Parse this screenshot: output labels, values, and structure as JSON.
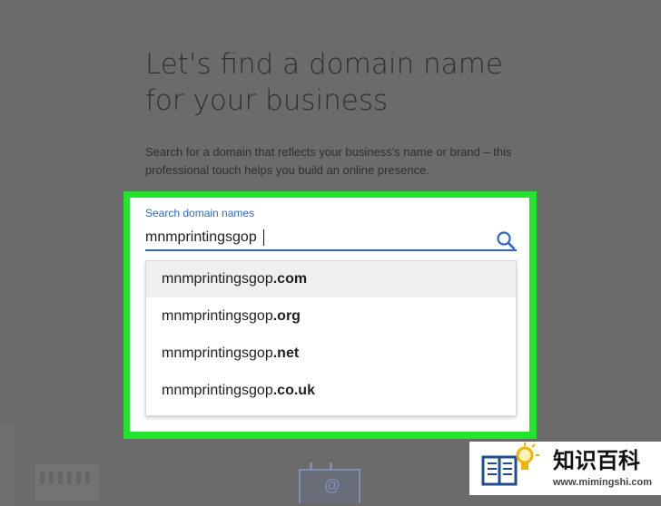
{
  "page": {
    "headline": "Let's find a domain name for your business",
    "subtext": "Search for a domain that reflects your business's name or brand – this professional touch helps you build an online presence."
  },
  "search": {
    "label": "Search domain names",
    "value": "mnmprintingsgop",
    "icon": "search-icon"
  },
  "suggestions": [
    {
      "base": "mnmprintingsgop",
      "tld": ".com",
      "highlighted": true
    },
    {
      "base": "mnmprintingsgop",
      "tld": ".org",
      "highlighted": false
    },
    {
      "base": "mnmprintingsgop",
      "tld": ".net",
      "highlighted": false
    },
    {
      "base": "mnmprintingsgop",
      "tld": ".co.uk",
      "highlighted": false
    }
  ],
  "background": {
    "overlay_color": "#6b6b6b",
    "accent_frame_color": "#22e32d",
    "billboard_symbol": "@"
  },
  "watermark": {
    "title": "知识百科",
    "url": "www.mimingshi.com"
  }
}
